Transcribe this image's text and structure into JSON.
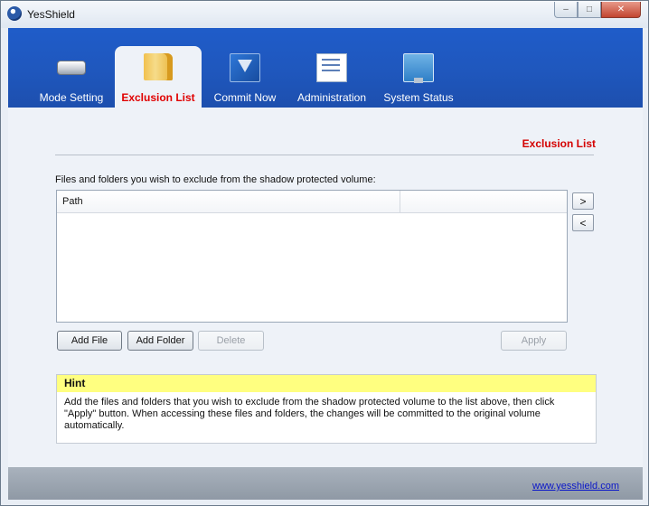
{
  "window": {
    "title": "YesShield",
    "controls": {
      "minimize": "–",
      "maximize": "□",
      "close": "✕"
    }
  },
  "tabs": [
    {
      "label": "Mode Setting",
      "icon": "drive-icon"
    },
    {
      "label": "Exclusion List",
      "icon": "folder-icon",
      "active": true
    },
    {
      "label": "Commit Now",
      "icon": "commit-icon"
    },
    {
      "label": "Administration",
      "icon": "admin-icon"
    },
    {
      "label": "System Status",
      "icon": "status-icon"
    }
  ],
  "main": {
    "section_title": "Exclusion List",
    "intro": "Files and folders you wish to exclude from the shadow protected volume:",
    "list": {
      "columns": [
        "Path",
        ""
      ],
      "rows": []
    },
    "side_buttons": {
      "right": ">",
      "left": "<"
    },
    "buttons": {
      "add_file": "Add File",
      "add_folder": "Add Folder",
      "delete": "Delete",
      "apply": "Apply"
    },
    "hint": {
      "title": "Hint",
      "text": "Add the files and folders that you wish to exclude from the shadow protected volume to the list above, then click \"Apply\" button. When accessing these files and folders, the changes will be committed to the original volume automatically."
    }
  },
  "footer": {
    "link": "www.yesshield.com"
  },
  "colors": {
    "header_blue": "#1f57bd",
    "accent_red": "#d40000",
    "hint_yellow": "#ffff80"
  }
}
